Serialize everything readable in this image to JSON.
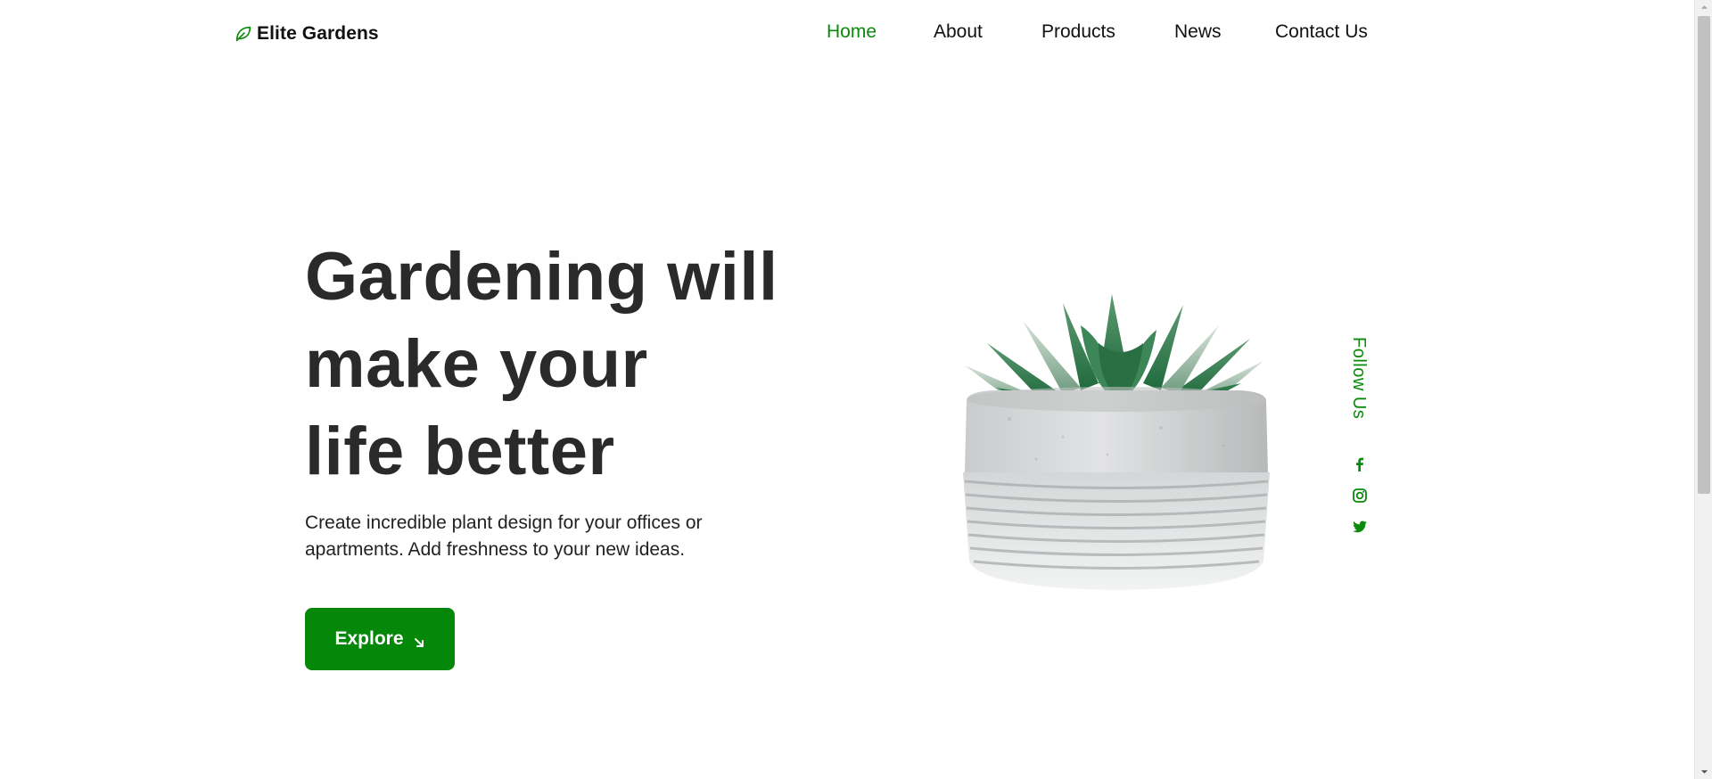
{
  "brand": {
    "name": "Elite Gardens",
    "icon": "leaf-icon",
    "accent": "#0a8a0a"
  },
  "nav": {
    "items": [
      {
        "label": "Home",
        "active": true
      },
      {
        "label": "About",
        "active": false
      },
      {
        "label": "Products",
        "active": false
      },
      {
        "label": "News",
        "active": false
      },
      {
        "label": "Contact Us",
        "active": false
      }
    ]
  },
  "hero": {
    "title_lines": [
      "Gardening will",
      "make your",
      "life better"
    ],
    "description": "Create incredible plant design for your offices or apartments. Add freshness to your new ideas.",
    "cta_label": "Explore",
    "cta_icon": "arrow-down-right-icon",
    "cta_color": "#05870a",
    "image": "potted-succulent-image"
  },
  "follow": {
    "label": "Follow Us",
    "socials": [
      "facebook-icon",
      "instagram-icon",
      "twitter-icon"
    ]
  }
}
